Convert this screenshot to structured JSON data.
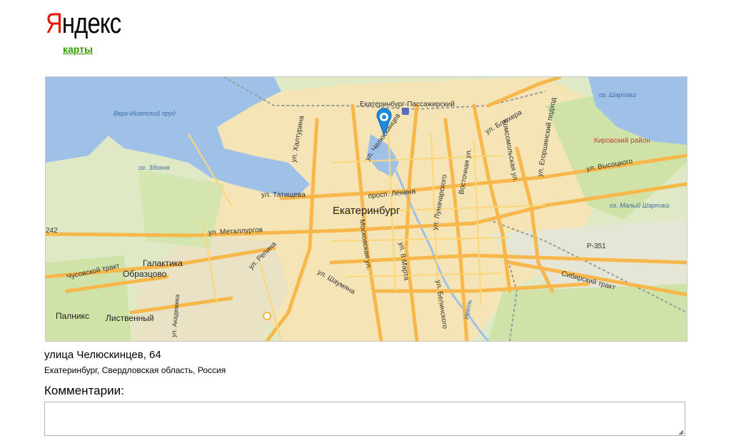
{
  "header": {
    "logo_first_letter": "Я",
    "logo_rest": "ндекс",
    "service_link": "карты"
  },
  "map": {
    "labels": {
      "station": "Екатеринбург-Пассажирский",
      "pond": "Верх-Исетский пруд",
      "lake_zdokhnya": "оз. Здохня",
      "lake_shartash": "оз. Шарташ",
      "lake_maly_shartash": "оз. Малый Шарташ",
      "district_kirovsky": "Кировский район",
      "city": "Екатеринбург",
      "khalturina": "ул. Халтурина",
      "chelyuskintsev": "ул. Челюскинцев",
      "tatishcheva": "ул. Татищева",
      "lenina": "просп. Ленина",
      "lunacharskogo": "ул. Луначарского",
      "vostochnaya": "Восточная ул.",
      "blyukhera": "ул. Блюхера",
      "komsomolskaya": "Комсомольская ул.",
      "egorshinsky": "ул. Егоршинский подход",
      "vysotskogo": "ул. Высоцкого",
      "metallurgov": "ул. Металлургов",
      "moskovskaya": "Московская ул.",
      "vos_marta": "ул. 8 Марта",
      "repina": "ул. Репина",
      "shaumyana": "ул. Шаумяна",
      "belinskogo": "ул. Белинского",
      "iset": "Исеть",
      "sibirsky": "Сибирский тракт",
      "r351": "Р-351",
      "r242": "242",
      "chusovskoy": "Чусовской тракт",
      "galaktika": "Галактика",
      "obraztsovo": "Образцово",
      "palniks": "Палникс",
      "listvenny": "Лиственный",
      "akademicheskaya": "ул. Академика"
    }
  },
  "address": {
    "title": "улица Челюскинцев, 64",
    "subtitle": "Екатеринбург, Свердловская область, Россия"
  },
  "comments": {
    "label": "Комментарии:",
    "value": ""
  },
  "colors": {
    "logo_red": "#e61400",
    "link_green": "#339900",
    "water": "#9fc1e8",
    "green_area": "#d6e8b8",
    "urban": "#f6e5b4",
    "road": "#f7b74a",
    "marker": "#1a8ce0"
  },
  "icons": {
    "marker": "map-marker-icon",
    "train": "train-station-icon",
    "grip": "resize-grip-icon"
  }
}
